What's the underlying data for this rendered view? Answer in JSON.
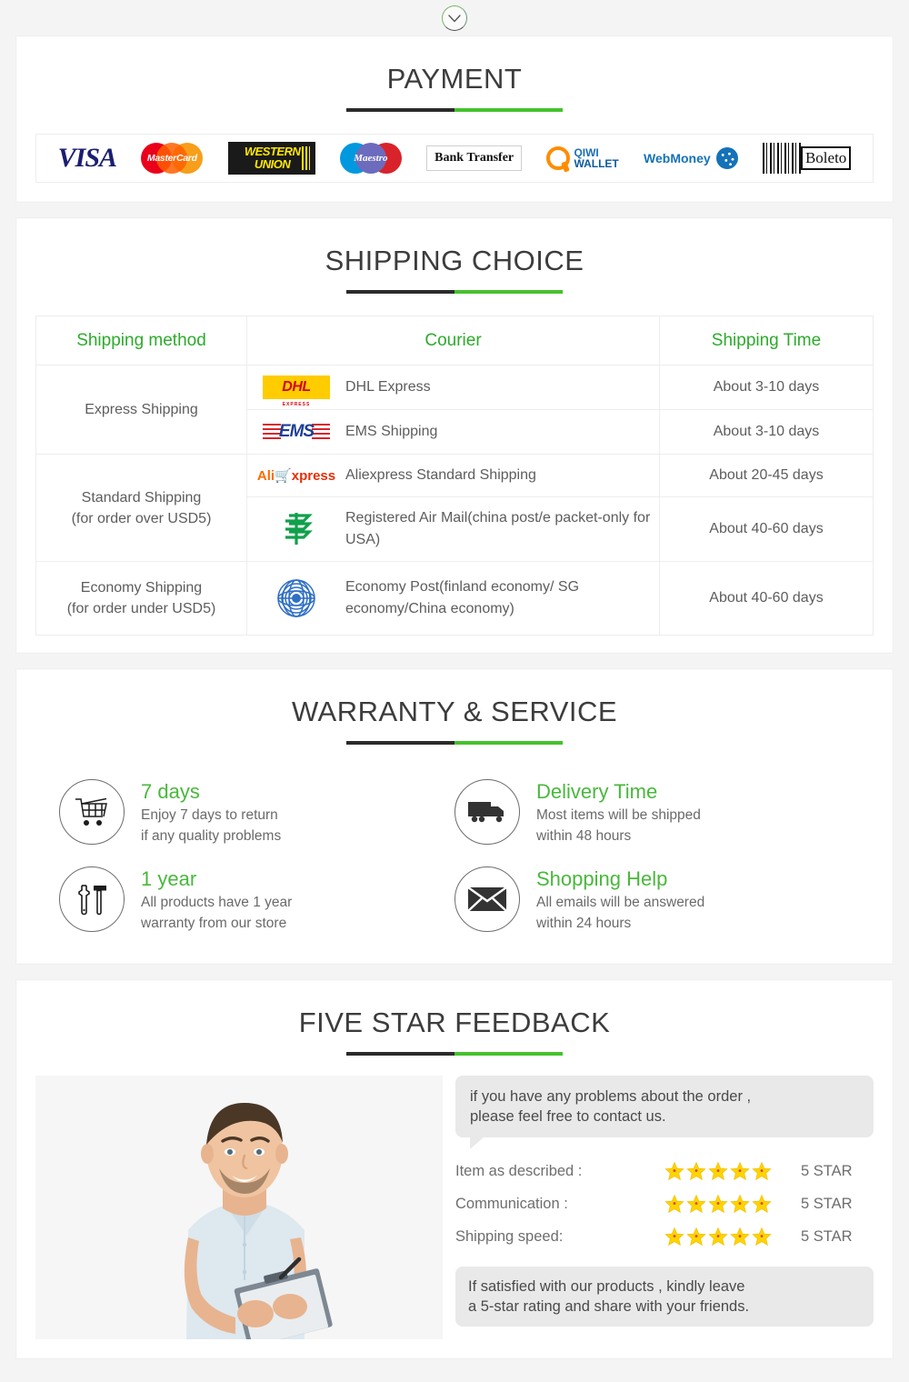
{
  "top": {
    "chevron_icon": "chevron-down-icon"
  },
  "payment": {
    "title": "PAYMENT",
    "methods": [
      {
        "name": "visa",
        "label": "VISA"
      },
      {
        "name": "mastercard",
        "label": "MasterCard"
      },
      {
        "name": "western-union",
        "label_line1": "WESTERN",
        "label_line2": "UNION"
      },
      {
        "name": "maestro",
        "label": "Maestro"
      },
      {
        "name": "bank-transfer",
        "label": "Bank Transfer"
      },
      {
        "name": "qiwi-wallet",
        "label_line1": "QIWI",
        "label_line2": "WALLET"
      },
      {
        "name": "webmoney",
        "label": "WebMoney"
      },
      {
        "name": "boleto",
        "label": "Boleto"
      }
    ]
  },
  "shipping": {
    "title": "SHIPPING CHOICE",
    "headers": [
      "Shipping method",
      "Courier",
      "Shipping Time"
    ],
    "rows": [
      {
        "method": "Express Shipping",
        "method_note": "",
        "couriers": [
          {
            "logo": "dhl-logo",
            "name": "DHL Express",
            "time": "About 3-10 days"
          },
          {
            "logo": "ems-logo",
            "name": "EMS Shipping",
            "time": "About 3-10 days"
          }
        ]
      },
      {
        "method": "Standard Shipping",
        "method_note": "(for order over USD5)",
        "couriers": [
          {
            "logo": "aliexpress-logo",
            "name": "Aliexpress Standard Shipping",
            "time": "About 20-45 days"
          },
          {
            "logo": "china-post-logo",
            "name": "Registered Air Mail(china post/e packet-only for USA)",
            "time": "About 40-60 days"
          }
        ]
      },
      {
        "method": "Economy Shipping",
        "method_note": "(for order under USD5)",
        "couriers": [
          {
            "logo": "un-post-logo",
            "name": "Economy Post(finland economy/ SG economy/China economy)",
            "time": "About 40-60 days"
          }
        ]
      }
    ]
  },
  "warranty": {
    "title": "WARRANTY & SERVICE",
    "items": [
      {
        "icon": "shopping-cart-icon",
        "head": "7 days",
        "line1": "Enjoy 7 days to return",
        "line2": "if any quality problems"
      },
      {
        "icon": "delivery-truck-icon",
        "head": "Delivery Time",
        "line1": "Most items will be shipped",
        "line2": "within 48 hours"
      },
      {
        "icon": "tools-icon",
        "head": "1 year",
        "line1": "All products have 1 year",
        "line2": "warranty from our store"
      },
      {
        "icon": "envelope-icon",
        "head": "Shopping Help",
        "line1": "All emails will be answered",
        "line2": "within 24 hours"
      }
    ]
  },
  "feedback": {
    "title": "FIVE STAR FEEDBACK",
    "photo_alt": "smiling-man-with-clipboard-photo",
    "bubble_line1": "if you have any problems about the order ,",
    "bubble_line2": "please feel free to contact us.",
    "ratings": [
      {
        "label": "Item as described :",
        "stars": 5,
        "value": "5 STAR"
      },
      {
        "label": "Communication :",
        "stars": 5,
        "value": "5 STAR"
      },
      {
        "label": "Shipping speed:",
        "stars": 5,
        "value": "5 STAR"
      }
    ],
    "footer_line1": "If satisfied with our products ,  kindly leave",
    "footer_line2": "a 5-star rating and share with your friends."
  },
  "colors": {
    "green": "#45c22c",
    "header_green": "#2cab2c",
    "dark": "#2b2b2b",
    "text_gray": "#5d5d5d",
    "star_yellow": "#ffd400",
    "page_bg": "#f4f4f4"
  }
}
